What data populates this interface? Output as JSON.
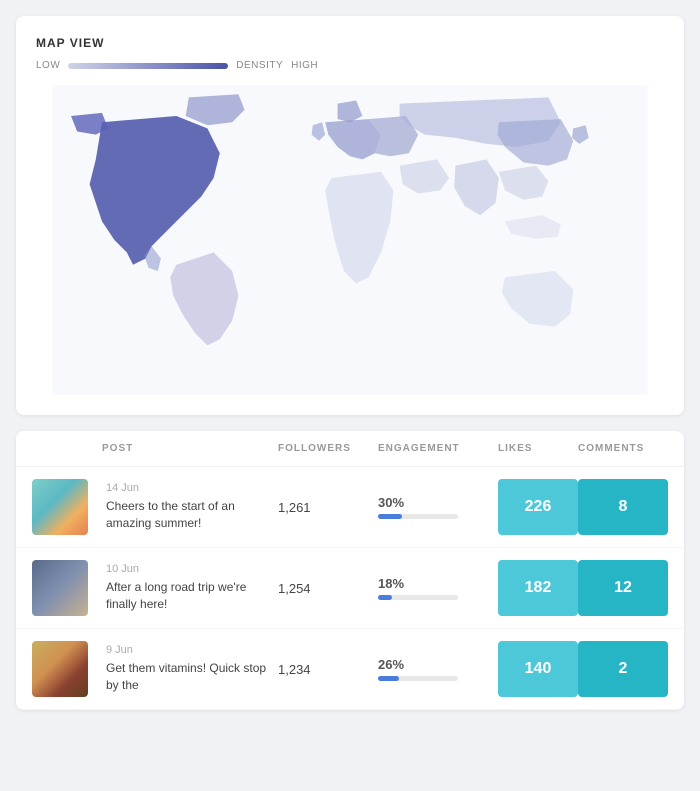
{
  "mapCard": {
    "title": "MAP VIEW",
    "densityLow": "LOW",
    "densityLabel": "DENSITY",
    "densityHigh": "HIGH"
  },
  "tableCard": {
    "columns": [
      "POST",
      "FOLLOWERS",
      "ENGAGEMENT",
      "LIKES",
      "COMMENTS"
    ],
    "rows": [
      {
        "date": "14 Jun",
        "text": "Cheers to the start of an amazing summer!",
        "followers": "1,261",
        "engagement": "30%",
        "engagementPct": 30,
        "likes": "226",
        "comments": "8",
        "thumb": "1"
      },
      {
        "date": "10 Jun",
        "text": "After a long road trip we're finally here!",
        "followers": "1,254",
        "engagement": "18%",
        "engagementPct": 18,
        "likes": "182",
        "comments": "12",
        "thumb": "2"
      },
      {
        "date": "9 Jun",
        "text": "Get them vitamins! Quick stop by the",
        "followers": "1,234",
        "engagement": "26%",
        "engagementPct": 26,
        "likes": "140",
        "comments": "2",
        "thumb": "3"
      }
    ]
  }
}
